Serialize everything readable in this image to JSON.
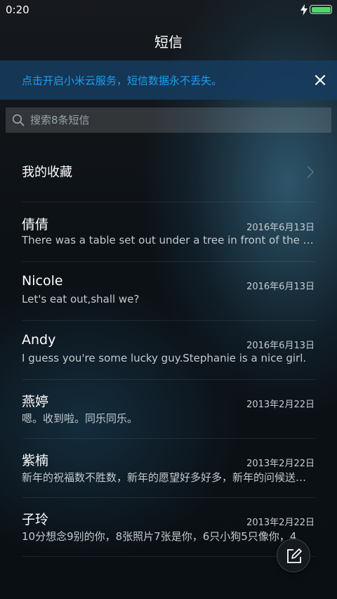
{
  "status_bar": {
    "time": "0:20",
    "battery_level": 1.0
  },
  "header": {
    "title": "短信"
  },
  "cloud_banner": {
    "text": "点击开启小米云服务，短信数据永不丢失。"
  },
  "search": {
    "placeholder": "搜索8条短信"
  },
  "favorites": {
    "label": "我的收藏"
  },
  "messages": [
    {
      "name": "倩倩",
      "date": "2016年6月13日",
      "preview": "There was a table set out under a tree in front of the house, and the March Hare and the Hatter were having tea at it"
    },
    {
      "name": "Nicole",
      "date": "2016年6月13日",
      "preview": "Let's eat out,shall we?"
    },
    {
      "name": "Andy",
      "date": "2016年6月13日",
      "preview": "I guess you're some lucky guy.Stephanie is a nice girl."
    },
    {
      "name": "燕婷",
      "date": "2013年2月22日",
      "preview": "嗯。收到啦。同乐同乐。"
    },
    {
      "name": "紫楠",
      "date": "2013年2月22日",
      "preview": "新年的祝福数不胜数，新年的愿望好多好多，新年的问候送给你"
    },
    {
      "name": "子玲",
      "date": "2013年2月22日",
      "preview": "10分想念9别的你，8张照片7张是你，6只小狗5只像你，4"
    }
  ],
  "icons": {
    "charging": "lightning-icon",
    "battery": "battery-icon",
    "close": "close-icon",
    "search": "search-icon",
    "chevron": "chevron-right-icon",
    "compose": "compose-icon"
  },
  "colors": {
    "accent": "#1e9df0",
    "battery": "#4cd964"
  }
}
